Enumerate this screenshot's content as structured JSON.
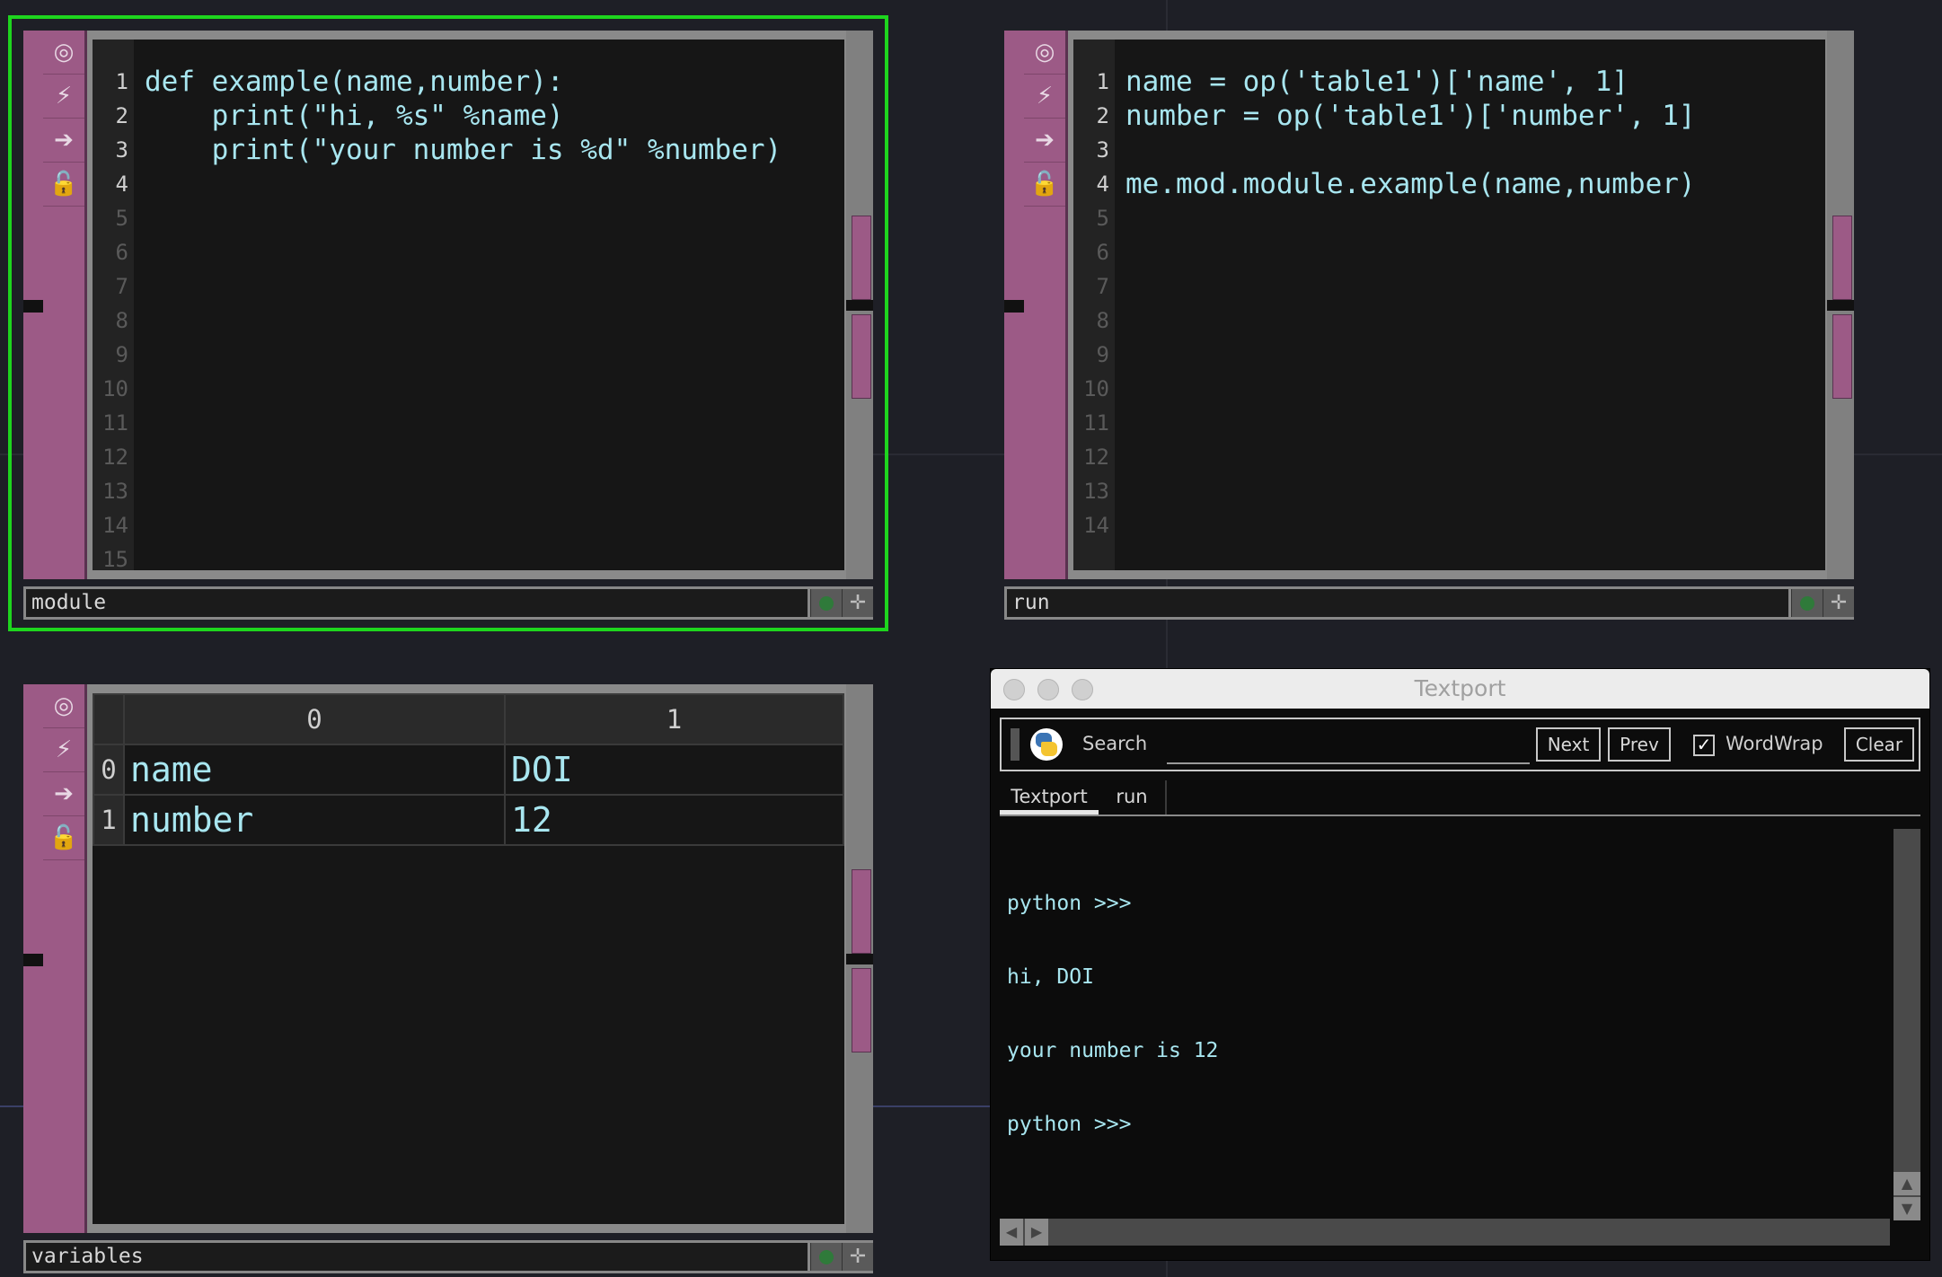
{
  "nodes": {
    "module": {
      "name": "module",
      "lines": [
        "def example(name,number):",
        "    print(\"hi, %s\" %name)",
        "    print(\"your number is %d\" %number)",
        ""
      ],
      "line_numbers": [
        "1",
        "2",
        "3",
        "4",
        "5",
        "6",
        "7",
        "8",
        "9",
        "10",
        "11",
        "12",
        "13",
        "14",
        "15"
      ]
    },
    "run": {
      "name": "run",
      "lines": [
        "name = op('table1')['name', 1]",
        "number = op('table1')['number', 1]",
        "",
        "me.mod.module.example(name,number)"
      ],
      "line_numbers": [
        "1",
        "2",
        "3",
        "4",
        "5",
        "6",
        "7",
        "8",
        "9",
        "10",
        "11",
        "12",
        "13",
        "14"
      ]
    },
    "variables": {
      "name": "variables",
      "col_headers": [
        "0",
        "1"
      ],
      "rows": [
        {
          "index": "0",
          "cells": [
            "name",
            "DOI"
          ]
        },
        {
          "index": "1",
          "cells": [
            "number",
            "12"
          ]
        }
      ]
    }
  },
  "node_icons": [
    "viewer-toggle-icon",
    "cook-icon",
    "export-icon",
    "lock-icon"
  ],
  "textport": {
    "title": "Textport",
    "search_label": "Search",
    "search_value": "",
    "buttons": {
      "next": "Next",
      "prev": "Prev",
      "wordwrap": "WordWrap",
      "clear": "Clear"
    },
    "wordwrap_checked": true,
    "tabs": [
      "Textport",
      "run"
    ],
    "active_tab": "Textport",
    "output": [
      "python >>>",
      "hi, DOI",
      "your number is 12",
      "python >>>"
    ]
  },
  "colors": {
    "selection": "#1ed51e",
    "node_pink": "#9c5a86",
    "code_text": "#a8e6f0"
  }
}
